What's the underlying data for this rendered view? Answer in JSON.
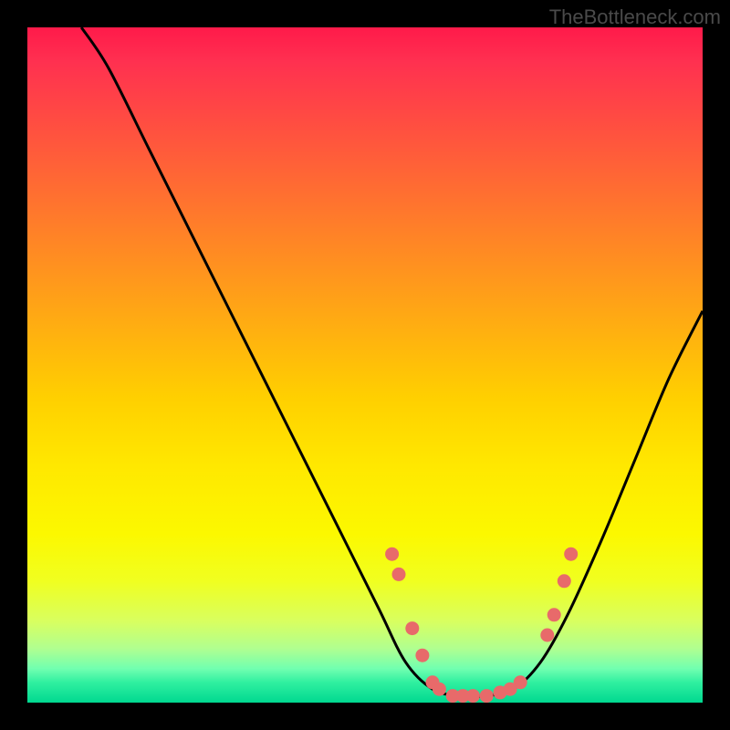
{
  "watermark": "TheBottleneck.com",
  "chart_data": {
    "type": "line",
    "title": "",
    "xlabel": "",
    "ylabel": "",
    "xlim": [
      0,
      100
    ],
    "ylim": [
      0,
      100
    ],
    "curve": [
      {
        "x": 8,
        "y": 100
      },
      {
        "x": 12,
        "y": 94
      },
      {
        "x": 18,
        "y": 82
      },
      {
        "x": 25,
        "y": 68
      },
      {
        "x": 32,
        "y": 54
      },
      {
        "x": 39,
        "y": 40
      },
      {
        "x": 46,
        "y": 26
      },
      {
        "x": 52,
        "y": 14
      },
      {
        "x": 56,
        "y": 6
      },
      {
        "x": 60,
        "y": 2
      },
      {
        "x": 64,
        "y": 1
      },
      {
        "x": 68,
        "y": 1
      },
      {
        "x": 72,
        "y": 2
      },
      {
        "x": 76,
        "y": 6
      },
      {
        "x": 80,
        "y": 13
      },
      {
        "x": 85,
        "y": 24
      },
      {
        "x": 90,
        "y": 36
      },
      {
        "x": 95,
        "y": 48
      },
      {
        "x": 100,
        "y": 58
      }
    ],
    "markers": [
      {
        "x": 54,
        "y": 22
      },
      {
        "x": 55,
        "y": 19
      },
      {
        "x": 57,
        "y": 11
      },
      {
        "x": 58.5,
        "y": 7
      },
      {
        "x": 60,
        "y": 3
      },
      {
        "x": 61,
        "y": 2
      },
      {
        "x": 63,
        "y": 1
      },
      {
        "x": 64.5,
        "y": 1
      },
      {
        "x": 66,
        "y": 1
      },
      {
        "x": 68,
        "y": 1
      },
      {
        "x": 70,
        "y": 1.5
      },
      {
        "x": 71.5,
        "y": 2
      },
      {
        "x": 73,
        "y": 3
      },
      {
        "x": 77,
        "y": 10
      },
      {
        "x": 78,
        "y": 13
      },
      {
        "x": 79.5,
        "y": 18
      },
      {
        "x": 80.5,
        "y": 22
      }
    ],
    "gradient_stops": [
      {
        "pos": 0,
        "color": "#ff1a4a"
      },
      {
        "pos": 50,
        "color": "#ffd000"
      },
      {
        "pos": 100,
        "color": "#00d890"
      }
    ]
  }
}
